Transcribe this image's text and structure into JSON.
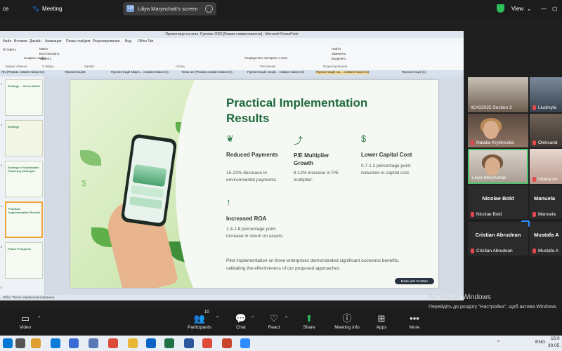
{
  "zoom": {
    "top_left_fragment": "ce",
    "meeting_label": "Meeting",
    "share_initials": "LM",
    "share_label": "Liliya Marynchak's screen",
    "view_label": "View",
    "colors": {
      "shield": "#2dbd5a",
      "toolbar_bg": "#1c1c1c"
    }
  },
  "powerpoint": {
    "window_title": "Презентація на англ. Рукопис 2025 [Режим совместимости] - Microsoft PowerPoint",
    "ribbon_tabs": [
      "Файл",
      "Вставка",
      "Дизайн",
      "Анимация",
      "Показ слайдов",
      "Рецензирование",
      "Вид",
      "Office Tab"
    ],
    "ribbon_buttons": [
      "Вставить",
      "Макет",
      "Восстановить",
      "Удалить",
      "Создать слайд",
      "Найти",
      "Заменить",
      "Выделить",
      "Упорядочить",
      "Экспресс-стили"
    ],
    "ribbon_groups": [
      "Буфер обмена",
      "Слайды",
      "Шрифт",
      "Абзац",
      "Рисование",
      "Редактирование"
    ],
    "doc_tabs": [
      "Ліз (Режим совместимости)",
      "Презентація1",
      "Презентація Марн... совместимости)",
      "Тема 12 (Режим совместимости)",
      "Презентація конф... совместимости)",
      "Презентація на... совместимости)",
      "Презентація (1)"
    ],
    "thumbnail_numbers": [
      "1",
      "2",
      "3",
      "4",
      "5",
      "6"
    ],
    "thumbnail_titles": [
      "Strategy ... Green Model",
      "Strategy",
      "Strategy of Sustainable Financing Strategies",
      "Practical Implementation Results",
      "Future Prospects"
    ],
    "status_text": "Office Theme   Украинский (Украина)"
  },
  "slide": {
    "title": "Practical Implementation Results",
    "features": [
      {
        "icon": "leaf-icon",
        "glyph": "❦",
        "heading": "Reduced Payments",
        "body": "15-22% decrease in environmental payments."
      },
      {
        "icon": "trend-up-icon",
        "glyph": "⤴",
        "heading": "P/E Multiplier Growth",
        "body": "8-12% increase in P/E multiplier."
      },
      {
        "icon": "dollar-icon",
        "glyph": "$",
        "heading": "Lower Capital Cost",
        "body": "0.7-1.2 percentage point reduction in capital cost."
      },
      {
        "icon": "arrow-up-icon",
        "glyph": "↑",
        "heading": "Increased ROA",
        "body": "1.3-1.8 percentage point increase in return on assets."
      }
    ],
    "footer": "Pilot implementation on three enterprises demonstrated significant economic benefits, validating the effectiveness of our proposed approaches.",
    "badge": "Made with GAMMA",
    "colors": {
      "title": "#1d6a3f",
      "accent": "#2e7d4a"
    }
  },
  "participants": [
    {
      "name": "ICAS2025 Section 3",
      "type": "video"
    },
    {
      "name": "Liudmyla",
      "type": "video"
    },
    {
      "name": "Natalia Krykhivska",
      "type": "video"
    },
    {
      "name": "Oleksand",
      "type": "video"
    },
    {
      "name": "Liliya Marynchak",
      "type": "video",
      "speaking": true
    },
    {
      "name": "Uliana An",
      "type": "video"
    },
    {
      "name": "Nicolae Bold",
      "type": "name"
    },
    {
      "name": "Manuela",
      "type": "name"
    },
    {
      "name": "Cristian Abrudean",
      "type": "name"
    },
    {
      "name": "Mustafa A",
      "type": "name"
    }
  ],
  "windows_activation": {
    "line1": "Активація Windows",
    "line2": "Перейдіть до розділу \"Настройки\", щоб актива Windows."
  },
  "toolbar": [
    {
      "icon": "video-camera-icon",
      "label": "Video"
    },
    {
      "icon": "participants-icon",
      "label": "Participants",
      "count": "10"
    },
    {
      "icon": "chat-icon",
      "label": "Chat"
    },
    {
      "icon": "react-heart-icon",
      "label": "React"
    },
    {
      "icon": "share-screen-icon",
      "label": "Share"
    },
    {
      "icon": "info-icon",
      "label": "Meeting info"
    },
    {
      "icon": "apps-icon",
      "label": "Apps"
    },
    {
      "icon": "more-icon",
      "label": "More"
    }
  ],
  "taskbar": {
    "language": "ENG",
    "time": "15:0",
    "date": "30.05."
  }
}
